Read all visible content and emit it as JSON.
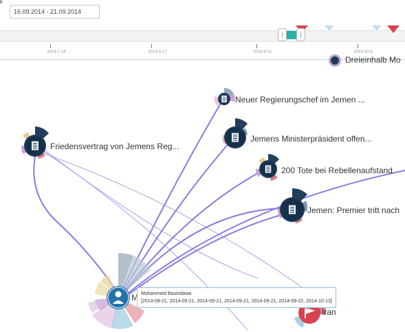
{
  "date_range": "16.09.2014  -  21.09.2014",
  "timeline": {
    "ticks": [
      "2014-7-24",
      "2014-8-17",
      "2014-9-11",
      "2014-10-5"
    ]
  },
  "nodes": [
    {
      "label": "Dreieinhalb Mo",
      "icon": "document-icon"
    },
    {
      "label": "Neuer Regierungschef im Jemen ...",
      "icon": "document-icon"
    },
    {
      "label": "Jemens Ministerpräsident offen...",
      "icon": "document-icon"
    },
    {
      "label": "Friedensvertrag von Jemens Reg...",
      "icon": "document-icon"
    },
    {
      "label": "200 Tote bei Rebellenaufstand",
      "icon": "document-icon"
    },
    {
      "label": "Jemen: Premier tritt nach",
      "icon": "document-icon"
    },
    {
      "label": "Iran",
      "icon": "flag-icon"
    },
    {
      "label": "M",
      "icon": "person-icon"
    }
  ],
  "tooltip": {
    "name": "Mohammed Basindawa",
    "dates": "[2014-09-21, 2014-09-21, 2014-09-21, 2014-09-21, 2014-09-21, 2014-09-22, 2014-10-13]"
  },
  "colors": {
    "edge": "#8a7ae0",
    "node_dark": "#1d3b59",
    "person_node": "#2e7fb8",
    "slider": "#26b2a8",
    "marker_red": "#d9434f",
    "marker_blue": "#c3dcee"
  }
}
